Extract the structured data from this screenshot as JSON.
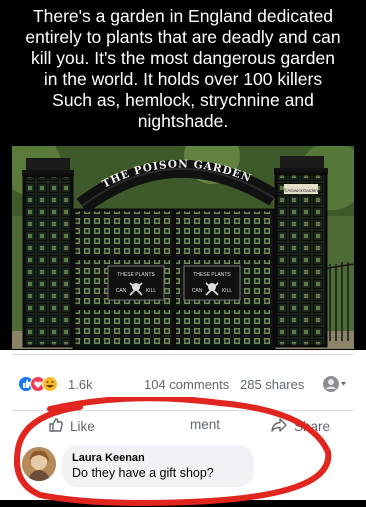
{
  "caption": {
    "lines": [
      "There's a garden in England dedicated",
      "entirely to plants that are deadly and can",
      "kill you. It's the most dangerous garden",
      "in the world. It holds over 100 killers",
      "Such as, hemlock, strychnine and",
      "nightshade."
    ]
  },
  "photo": {
    "arch_sign": "THE POISON GARDEN",
    "plaque_small": "©AlnwickGarden",
    "left_sign": {
      "line1": "THESE PLANTS",
      "line2": "CAN",
      "line3": "KILL"
    },
    "right_sign": {
      "line1": "THESE PLANTS",
      "line2": "CAN",
      "line3": "KILL"
    }
  },
  "post": {
    "reaction_count": "1.6k",
    "comments": "104 comments",
    "shares": "285 shares",
    "like_label": "Like",
    "comment_label": "ment",
    "share_label": "Share",
    "colors": {
      "like_blue": "#1877f2",
      "love_red": "#f33e58",
      "haha_yellow": "#f7b928",
      "circle_red": "#e0261f"
    }
  },
  "comment": {
    "author": "Laura Keenan",
    "text": "Do they have a gift shop?"
  }
}
